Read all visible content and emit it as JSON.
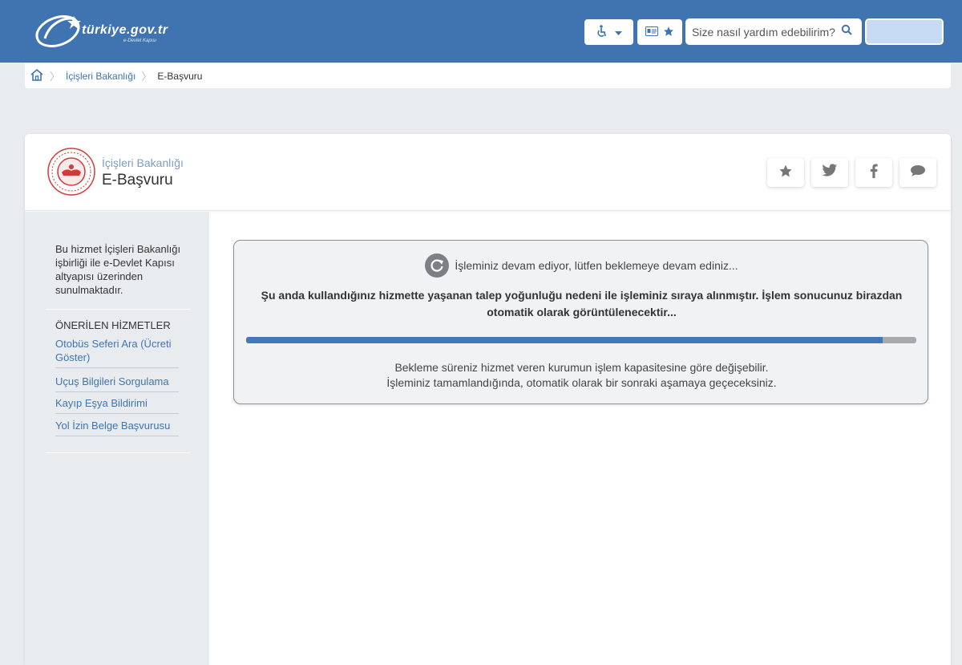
{
  "header": {
    "logo_text": "türkiye.gov.tr",
    "logo_subtext": "e-Devlet Kapısı",
    "search_placeholder": "Size nasıl yardım edebilirim?"
  },
  "breadcrumb": {
    "items": [
      "İçişleri Bakanlığı",
      "E-Başvuru"
    ]
  },
  "service": {
    "organization": "İçişleri Bakanlığı",
    "title": "E-Başvuru"
  },
  "sidebar": {
    "description": "Bu hizmet İçişleri Bakanlığı işbirliği ile e-Devlet Kapısı altyapısı üzerinden sunulmaktadır.",
    "suggested_title": "ÖNERİLEN HİZMETLER",
    "suggested": [
      "Otobüs Seferi Ara (Ücreti Göster)",
      "Uçuş Bilgileri Sorgulama",
      "Kayıp Eşya Bildirimi",
      "Yol İzin Belge Başvurusu"
    ]
  },
  "wait": {
    "status": "İşleminiz devam ediyor, lütfen beklemeye devam ediniz...",
    "message": "Şu anda kullandığınız hizmette yaşanan talep yoğunluğu nedeni ile işleminiz sıraya alınmıştır. İşlem sonucunuz birazdan otomatik olarak görüntülenecektir...",
    "progress": 0.95,
    "info_line1": "Bekleme süreniz hizmet veren kurumun işlem kapasitesine göre değişebilir.",
    "info_line2": "İşleminiz tamamlandığında, otomatik olarak bir sonraki aşamaya geçeceksiniz."
  },
  "colors": {
    "header_bg": "#3f74b0",
    "link": "#3f74b0",
    "progress_fill": "#4378b6",
    "progress_track": "#a7a9ac"
  },
  "icons": [
    "home-icon",
    "accessibility-icon",
    "chevron-down-icon",
    "id-card-icon",
    "star-icon",
    "search-icon",
    "twitter-icon",
    "facebook-icon",
    "comment-icon",
    "refresh-icon",
    "ministry-seal-icon"
  ]
}
